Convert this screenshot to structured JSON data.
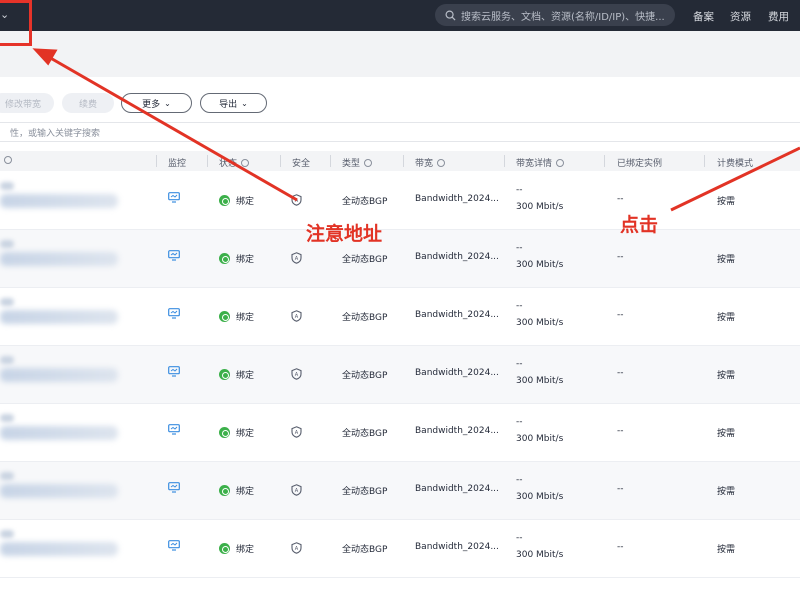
{
  "topbar": {
    "search_placeholder": "搜索云服务、文档、资源(名称/ID/IP)、快捷...",
    "links": [
      "备案",
      "资源",
      "费用"
    ]
  },
  "toolbar": {
    "modify_bandwidth": "修改带宽",
    "renew": "续费",
    "more": "更多",
    "export": "导出"
  },
  "filter": {
    "placeholder": "性，或输入关键字搜索"
  },
  "table": {
    "columns": [
      "监控",
      "状态",
      "安全",
      "类型",
      "带宽",
      "带宽详情",
      "已绑定实例",
      "计费模式"
    ],
    "rows": [
      {
        "status": "绑定",
        "type": "全动态BGP",
        "bandwidth": "Bandwidth_2024...",
        "detail_top": "--",
        "detail": "300 Mbit/s",
        "instance": "--",
        "billing": "按需"
      },
      {
        "status": "绑定",
        "type": "全动态BGP",
        "bandwidth": "Bandwidth_2024...",
        "detail_top": "--",
        "detail": "300 Mbit/s",
        "instance": "--",
        "billing": "按需"
      },
      {
        "status": "绑定",
        "type": "全动态BGP",
        "bandwidth": "Bandwidth_2024...",
        "detail_top": "--",
        "detail": "300 Mbit/s",
        "instance": "--",
        "billing": "按需"
      },
      {
        "status": "绑定",
        "type": "全动态BGP",
        "bandwidth": "Bandwidth_2024...",
        "detail_top": "--",
        "detail": "300 Mbit/s",
        "instance": "--",
        "billing": "按需"
      },
      {
        "status": "绑定",
        "type": "全动态BGP",
        "bandwidth": "Bandwidth_2024...",
        "detail_top": "--",
        "detail": "300 Mbit/s",
        "instance": "--",
        "billing": "按需"
      },
      {
        "status": "绑定",
        "type": "全动态BGP",
        "bandwidth": "Bandwidth_2024...",
        "detail_top": "--",
        "detail": "300 Mbit/s",
        "instance": "--",
        "billing": "按需"
      },
      {
        "status": "绑定",
        "type": "全动态BGP",
        "bandwidth": "Bandwidth_2024...",
        "detail_top": "--",
        "detail": "300 Mbit/s",
        "instance": "--",
        "billing": "按需"
      }
    ]
  },
  "annotations": {
    "note_address": "注意地址",
    "click": "点击"
  },
  "colors": {
    "annotation": "#e23325",
    "status_ok": "#3cb04a",
    "monitor_icon": "#3a8de0"
  }
}
